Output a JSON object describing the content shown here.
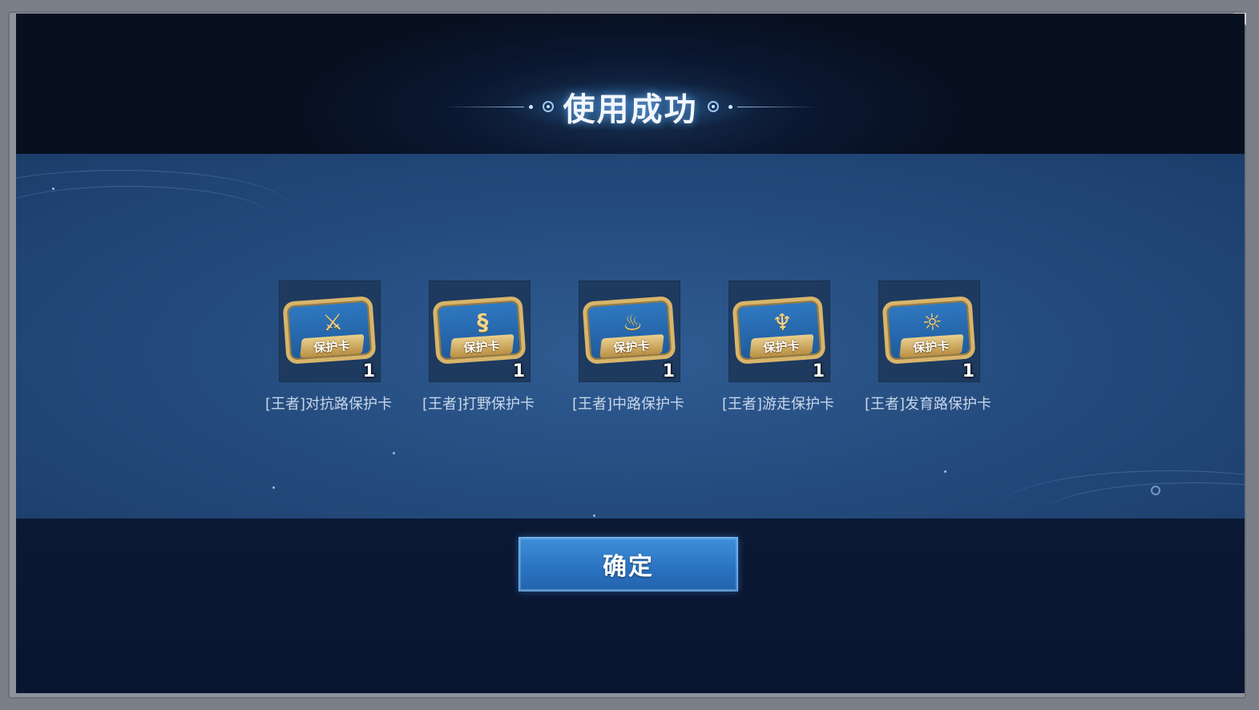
{
  "dialog": {
    "title": "使用成功",
    "confirm_label": "确定"
  },
  "items": [
    {
      "name": "[王者]对抗路保护卡",
      "card_text": "保护卡",
      "quantity": "1",
      "emblem": "crossed-swords-icon"
    },
    {
      "name": "[王者]打野保护卡",
      "card_text": "保护卡",
      "quantity": "1",
      "emblem": "dragon-icon"
    },
    {
      "name": "[王者]中路保护卡",
      "card_text": "保护卡",
      "quantity": "1",
      "emblem": "flame-icon"
    },
    {
      "name": "[王者]游走保护卡",
      "card_text": "保护卡",
      "quantity": "1",
      "emblem": "horned-helm-icon"
    },
    {
      "name": "[王者]发育路保护卡",
      "card_text": "保护卡",
      "quantity": "1",
      "emblem": "sun-crest-icon"
    }
  ],
  "colors": {
    "panel_blue": "#2f5c93",
    "card_gold": "#d8b56a",
    "button_blue": "#3f8fd8"
  }
}
